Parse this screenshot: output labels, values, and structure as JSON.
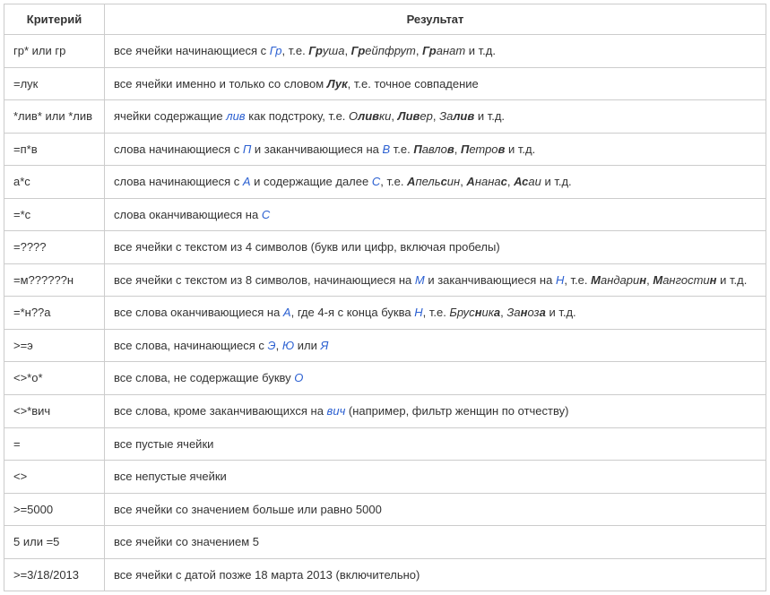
{
  "headers": {
    "col1": "Критерий",
    "col2": "Результат"
  },
  "rows": [
    {
      "crit": "гр* или гр",
      "parts": [
        {
          "t": "все ячейки начинающиеся с "
        },
        {
          "t": "Гр",
          "cls": "blue"
        },
        {
          "t": ", т.е. "
        },
        {
          "t": "Гр",
          "cls": "bi"
        },
        {
          "t": "уша",
          "cls": "plain-i"
        },
        {
          "t": ", "
        },
        {
          "t": "Гр",
          "cls": "bi"
        },
        {
          "t": "ейпфрут",
          "cls": "plain-i"
        },
        {
          "t": ", "
        },
        {
          "t": "Гр",
          "cls": "bi"
        },
        {
          "t": "анат",
          "cls": "plain-i"
        },
        {
          "t": "  и т.д."
        }
      ]
    },
    {
      "crit": "=лук",
      "parts": [
        {
          "t": "все ячейки именно и только со словом "
        },
        {
          "t": "Лук",
          "cls": "bi"
        },
        {
          "t": ", т.е. точное совпадение"
        }
      ]
    },
    {
      "crit": "*лив* или *лив",
      "parts": [
        {
          "t": "ячейки содержащие "
        },
        {
          "t": "лив",
          "cls": "blue"
        },
        {
          "t": " как подстроку, т.е. "
        },
        {
          "t": "О",
          "cls": "plain-i"
        },
        {
          "t": "лив",
          "cls": "bi"
        },
        {
          "t": "ки",
          "cls": "plain-i"
        },
        {
          "t": ", "
        },
        {
          "t": "Лив",
          "cls": "bi"
        },
        {
          "t": "ер",
          "cls": "plain-i"
        },
        {
          "t": ", "
        },
        {
          "t": "За",
          "cls": "plain-i"
        },
        {
          "t": "лив",
          "cls": "bi"
        },
        {
          "t": "  и т.д."
        }
      ]
    },
    {
      "crit": "=п*в",
      "parts": [
        {
          "t": "слова начинающиеся с "
        },
        {
          "t": "П",
          "cls": "blue"
        },
        {
          "t": " и заканчивающиеся на "
        },
        {
          "t": "В",
          "cls": "blue"
        },
        {
          "t": " т.е. "
        },
        {
          "t": "П",
          "cls": "bi"
        },
        {
          "t": "авло",
          "cls": "plain-i"
        },
        {
          "t": "в",
          "cls": "bi"
        },
        {
          "t": ", "
        },
        {
          "t": "П",
          "cls": "bi"
        },
        {
          "t": "етро",
          "cls": "plain-i"
        },
        {
          "t": "в",
          "cls": "bi"
        },
        {
          "t": "  и т.д."
        }
      ]
    },
    {
      "crit": "а*с",
      "parts": [
        {
          "t": "слова начинающиеся с "
        },
        {
          "t": "А",
          "cls": "blue"
        },
        {
          "t": " и содержащие далее "
        },
        {
          "t": "С",
          "cls": "blue"
        },
        {
          "t": ", т.е. "
        },
        {
          "t": "А",
          "cls": "bi"
        },
        {
          "t": "пель",
          "cls": "plain-i"
        },
        {
          "t": "с",
          "cls": "bi"
        },
        {
          "t": "ин",
          "cls": "plain-i"
        },
        {
          "t": ", "
        },
        {
          "t": "А",
          "cls": "bi"
        },
        {
          "t": "нана",
          "cls": "plain-i"
        },
        {
          "t": "с",
          "cls": "bi"
        },
        {
          "t": ", "
        },
        {
          "t": "Ас",
          "cls": "bi"
        },
        {
          "t": "аи",
          "cls": "plain-i"
        },
        {
          "t": "  и т.д."
        }
      ]
    },
    {
      "crit": "=*с",
      "parts": [
        {
          "t": "слова оканчивающиеся на "
        },
        {
          "t": "С",
          "cls": "blue"
        }
      ]
    },
    {
      "crit": "=????",
      "parts": [
        {
          "t": "все ячейки с текстом из 4 символов (букв или цифр, включая пробелы)"
        }
      ]
    },
    {
      "crit": "=м??????н",
      "parts": [
        {
          "t": "все ячейки с текстом из 8 символов, начинающиеся на "
        },
        {
          "t": "М",
          "cls": "blue"
        },
        {
          "t": " и заканчивающиеся на "
        },
        {
          "t": "Н",
          "cls": "blue"
        },
        {
          "t": ", т.е. "
        },
        {
          "t": "М",
          "cls": "bi"
        },
        {
          "t": "андари",
          "cls": "plain-i"
        },
        {
          "t": "н",
          "cls": "bi"
        },
        {
          "t": ", "
        },
        {
          "t": "М",
          "cls": "bi"
        },
        {
          "t": "ангости",
          "cls": "plain-i"
        },
        {
          "t": "н",
          "cls": "bi"
        },
        {
          "t": "  и т.д."
        }
      ]
    },
    {
      "crit": "=*н??а",
      "parts": [
        {
          "t": "все слова оканчивающиеся на "
        },
        {
          "t": "А",
          "cls": "blue"
        },
        {
          "t": ", где 4-я с конца буква "
        },
        {
          "t": "Н",
          "cls": "blue"
        },
        {
          "t": ", т.е. "
        },
        {
          "t": "Брус",
          "cls": "plain-i"
        },
        {
          "t": "н",
          "cls": "bi"
        },
        {
          "t": "ик",
          "cls": "plain-i"
        },
        {
          "t": "а",
          "cls": "bi"
        },
        {
          "t": ", "
        },
        {
          "t": "За",
          "cls": "plain-i"
        },
        {
          "t": "н",
          "cls": "bi"
        },
        {
          "t": "оз",
          "cls": "plain-i"
        },
        {
          "t": "а",
          "cls": "bi"
        },
        {
          "t": "  и т.д."
        }
      ]
    },
    {
      "crit": ">=э",
      "parts": [
        {
          "t": "все слова, начинающиеся с "
        },
        {
          "t": "Э",
          "cls": "blue"
        },
        {
          "t": ", "
        },
        {
          "t": "Ю",
          "cls": "blue"
        },
        {
          "t": " или "
        },
        {
          "t": "Я",
          "cls": "blue"
        }
      ]
    },
    {
      "crit": "<>*о*",
      "parts": [
        {
          "t": "все слова, не содержащие букву "
        },
        {
          "t": "О",
          "cls": "blue"
        }
      ]
    },
    {
      "crit": "<>*вич",
      "parts": [
        {
          "t": "все слова, кроме заканчивающихся на "
        },
        {
          "t": "вич",
          "cls": "blue"
        },
        {
          "t": " (например, фильтр женщин по отчеству)"
        }
      ]
    },
    {
      "crit": "=",
      "parts": [
        {
          "t": "все пустые ячейки"
        }
      ]
    },
    {
      "crit": "<>",
      "parts": [
        {
          "t": "все непустые ячейки"
        }
      ]
    },
    {
      "crit": ">=5000",
      "parts": [
        {
          "t": "все ячейки со значением больше или равно 5000"
        }
      ]
    },
    {
      "crit": "5 или =5",
      "parts": [
        {
          "t": "все ячейки со значением 5"
        }
      ]
    },
    {
      "crit": ">=3/18/2013",
      "parts": [
        {
          "t": "все ячейки с датой позже 18 марта 2013 (включительно)"
        }
      ]
    }
  ]
}
